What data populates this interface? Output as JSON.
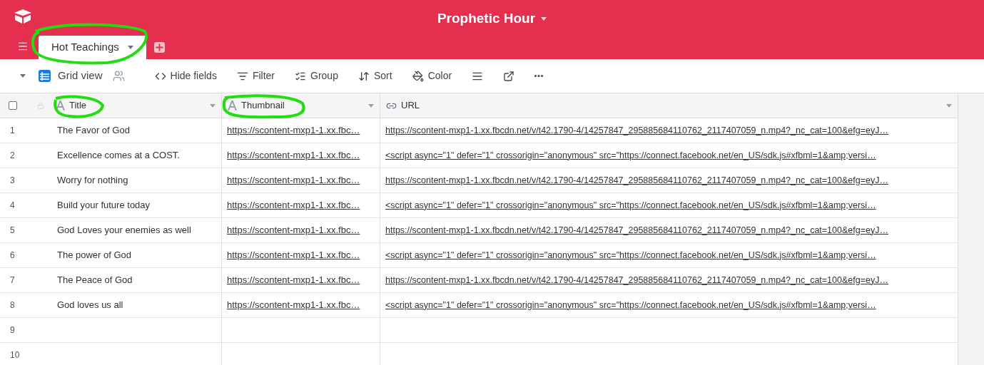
{
  "base_title": "Prophetic Hour",
  "tabs": [
    {
      "label": "Hot Teachings",
      "selected": true
    }
  ],
  "view": {
    "label": "Grid view"
  },
  "select_all": {
    "checked": false
  },
  "toolbar": [
    {
      "kind": "hide",
      "label": "Hide fields"
    },
    {
      "kind": "filter",
      "label": "Filter"
    },
    {
      "kind": "group",
      "label": "Group"
    },
    {
      "kind": "sort",
      "label": "Sort"
    },
    {
      "kind": "color",
      "label": "Color"
    },
    {
      "kind": "height"
    },
    {
      "kind": "share"
    },
    {
      "kind": "more"
    }
  ],
  "columns": [
    {
      "label": "Title",
      "kind": "text"
    },
    {
      "label": "Thumbnail",
      "kind": "text"
    },
    {
      "label": "URL",
      "kind": "url"
    }
  ],
  "rows": [
    {
      "number": "1",
      "title": "The Favor of God",
      "thumbnail": "https://scontent-mxp1-1.xx.fbc…",
      "url": "https://scontent-mxp1-1.xx.fbcdn.net/v/t42.1790-4/14257847_295885684110762_2117407059_n.mp4?_nc_cat=100&efg=eyJ…"
    },
    {
      "number": "2",
      "title": "Excellence comes at a COST.",
      "thumbnail": "https://scontent-mxp1-1.xx.fbc…",
      "url": "<script async=\"1\" defer=\"1\" crossorigin=\"anonymous\" src=\"https://connect.facebook.net/en_US/sdk.js#xfbml=1&amp;versi…"
    },
    {
      "number": "3",
      "title": "Worry for nothing",
      "thumbnail": "https://scontent-mxp1-1.xx.fbc…",
      "url": "https://scontent-mxp1-1.xx.fbcdn.net/v/t42.1790-4/14257847_295885684110762_2117407059_n.mp4?_nc_cat=100&efg=eyJ…"
    },
    {
      "number": "4",
      "title": "Build your future today",
      "thumbnail": "https://scontent-mxp1-1.xx.fbc…",
      "url": "<script async=\"1\" defer=\"1\" crossorigin=\"anonymous\" src=\"https://connect.facebook.net/en_US/sdk.js#xfbml=1&amp;versi…"
    },
    {
      "number": "5",
      "title": "God Loves your enemies as well",
      "thumbnail": "https://scontent-mxp1-1.xx.fbc…",
      "url": "https://scontent-mxp1-1.xx.fbcdn.net/v/t42.1790-4/14257847_295885684110762_2117407059_n.mp4?_nc_cat=100&efg=eyJ…"
    },
    {
      "number": "6",
      "title": "The power of God",
      "thumbnail": "https://scontent-mxp1-1.xx.fbc…",
      "url": "<script async=\"1\" defer=\"1\" crossorigin=\"anonymous\" src=\"https://connect.facebook.net/en_US/sdk.js#xfbml=1&amp;versi…"
    },
    {
      "number": "7",
      "title": "The Peace of God",
      "thumbnail": "https://scontent-mxp1-1.xx.fbc…",
      "url": "https://scontent-mxp1-1.xx.fbcdn.net/v/t42.1790-4/14257847_295885684110762_2117407059_n.mp4?_nc_cat=100&efg=eyJ…"
    },
    {
      "number": "8",
      "title": "God loves us all",
      "thumbnail": "https://scontent-mxp1-1.xx.fbc…",
      "url": "<script async=\"1\" defer=\"1\" crossorigin=\"anonymous\" src=\"https://connect.facebook.net/en_US/sdk.js#xfbml=1&amp;versi…"
    },
    {
      "number": "9"
    },
    {
      "number": "10"
    }
  ]
}
